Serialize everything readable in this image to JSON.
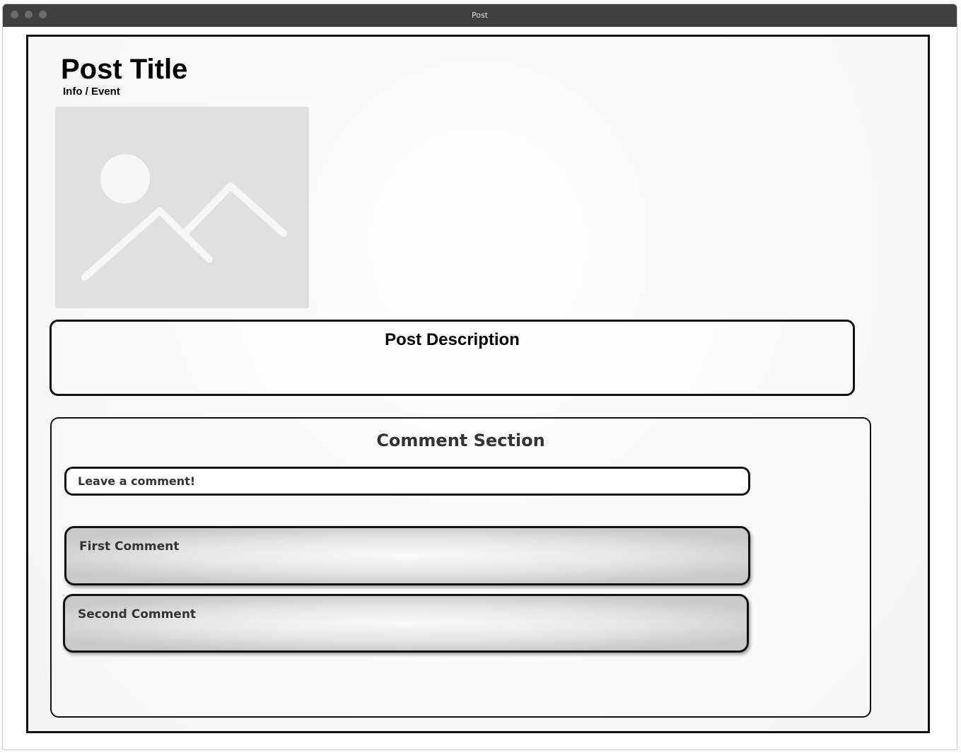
{
  "window": {
    "title": "Post"
  },
  "post": {
    "title": "Post Title",
    "meta": "Info / Event",
    "image_icon": "image-placeholder-icon"
  },
  "description": {
    "title": "Post Description"
  },
  "comments": {
    "title": "Comment Section",
    "input_placeholder": "Leave a comment!",
    "items": [
      {
        "text": "First Comment"
      },
      {
        "text": "Second Comment"
      }
    ]
  },
  "colors": {
    "titlebar": "#3f3f3f",
    "border": "#111111",
    "image_placeholder": "#e0e0e0"
  }
}
